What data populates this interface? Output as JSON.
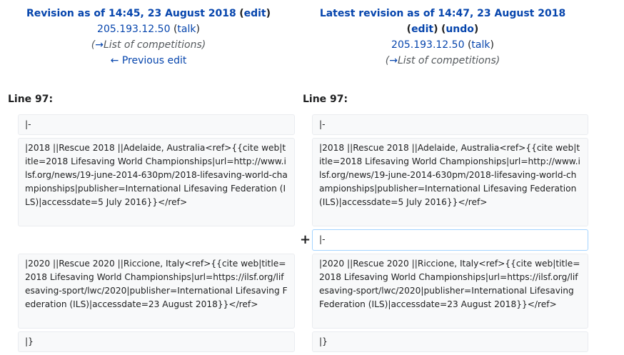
{
  "left_header": {
    "title": "Revision as of 14:45, 23 August 2018",
    "edit": "edit",
    "user": "205.193.12.50",
    "talk": "talk",
    "summary_arrow": "→",
    "summary": "List of competitions",
    "nav": "← Previous edit"
  },
  "right_header": {
    "title": "Latest revision as of 14:47, 23 August 2018",
    "edit": "edit",
    "undo": "undo",
    "user": "205.193.12.50",
    "talk": "talk",
    "summary_arrow": "→",
    "summary": "List of competitions"
  },
  "line_label": "Line 97:",
  "added_marker": "+",
  "rows": {
    "r1": "|-",
    "r2": "|2018 ||Rescue 2018 ||Adelaide, Australia<ref>{{cite web|title=2018 Lifesaving World Championships|url=http://www.ilsf.org/news/19-june-2014-630pm/2018-lifesaving-world-championships|publisher=International Lifesaving Federation (ILS)|accessdate=5 July 2016}}</ref>",
    "added": "|-",
    "r3": "|2020 ||Rescue 2020 ||Riccione, Italy<ref>{{cite web|title=2018 Lifesaving World Championships|url=https://ilsf.org/lifesaving-sport/lwc/2020|publisher=International Lifesaving Federation (ILS)|accessdate=23 August 2018}}</ref>",
    "r4": "|}"
  }
}
